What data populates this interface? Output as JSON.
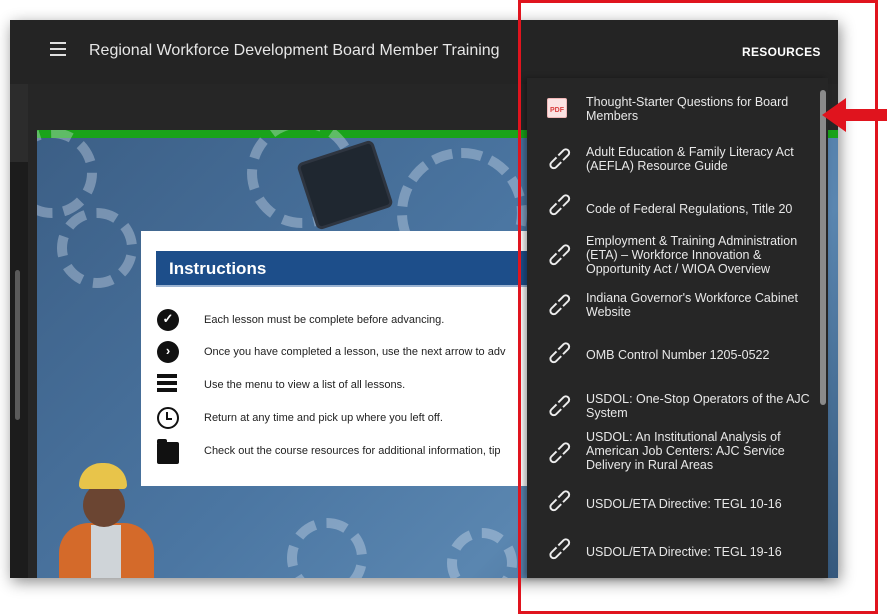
{
  "topbar": {
    "title": "Regional Workforce Development Board Member Training",
    "menu_icon": "hamburger-menu-icon",
    "resources_label": "RESOURCES"
  },
  "course": {
    "progress_percent": 100,
    "progress_color": "#1aa31a"
  },
  "instructions": {
    "heading": "Instructions",
    "header_color": "#1d4e8a",
    "items": [
      {
        "icon": "check-circle-icon",
        "text": "Each lesson must be complete before advancing."
      },
      {
        "icon": "next-arrow-circle-icon",
        "text": "Once you have completed a lesson, use the next arrow to adv"
      },
      {
        "icon": "menu-bars-icon",
        "text": "Use the menu to view a list of all lessons."
      },
      {
        "icon": "clock-icon",
        "text": "Return at any time and pick up where you left off."
      },
      {
        "icon": "folder-icon",
        "text": "Check out the course resources for additional information, tip"
      }
    ]
  },
  "resources": {
    "items": [
      {
        "icon": "pdf-icon",
        "pdf_text": "PDF",
        "label": "Thought-Starter Questions for Board Members"
      },
      {
        "icon": "link-icon",
        "label": "Adult Education & Family Literacy Act (AEFLA) Resource Guide"
      },
      {
        "icon": "link-icon",
        "label": "Code of Federal Regulations, Title 20"
      },
      {
        "icon": "link-icon",
        "label": "Employment & Training Administration (ETA) – Workforce Innovation & Opportunity Act / WIOA Overview"
      },
      {
        "icon": "link-icon",
        "label": "Indiana Governor's Workforce Cabinet Website"
      },
      {
        "icon": "link-icon",
        "label": "OMB Control Number 1205-0522"
      },
      {
        "icon": "link-icon",
        "label": "USDOL: One-Stop Operators of the AJC System"
      },
      {
        "icon": "link-icon",
        "label": "USDOL: An Institutional Analysis of American Job Centers: AJC Service Delivery in Rural Areas"
      },
      {
        "icon": "link-icon",
        "label": "USDOL/ETA Directive: TEGL 10-16"
      },
      {
        "icon": "link-icon",
        "label": "USDOL/ETA Directive: TEGL 19-16"
      }
    ]
  },
  "annotation": {
    "highlight_color": "#e0141e"
  }
}
